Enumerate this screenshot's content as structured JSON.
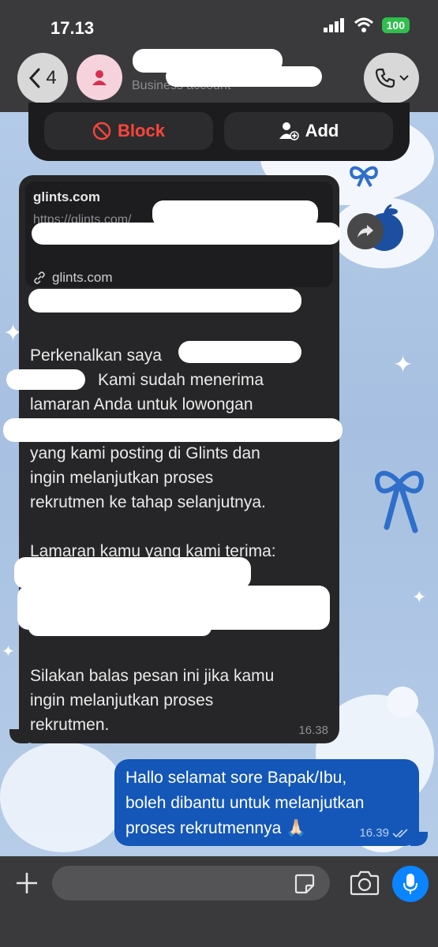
{
  "status_bar": {
    "time": "17.13",
    "battery": "100"
  },
  "header": {
    "back_count": "4",
    "contact_subtitle": "Business account"
  },
  "actions": {
    "block_label": "Block",
    "add_label": "Add"
  },
  "incoming": {
    "link_preview": {
      "title": "glints.com",
      "url": "https://glints.com/",
      "domain": "glints.com"
    },
    "paragraphs": [
      "Perkenalkan saya",
      "Kami sudah menerima",
      "lamaran Anda untuk lowongan",
      "yang kami posting di Glints dan",
      "ingin melanjutkan proses",
      "rekrutmen ke tahap selanjutnya.",
      "Lamaran kamu yang kami terima:",
      "Silakan balas pesan ini jika kamu",
      "ingin melanjutkan proses",
      "rekrutmen."
    ],
    "time": "16.38"
  },
  "outgoing": {
    "lines": [
      "Hallo selamat sore Bapak/Ibu,",
      "boleh dibantu untuk melanjutkan",
      "proses rekrutmennya 🙏🏻"
    ],
    "time": "16.39"
  },
  "icons": {
    "back": "chevron-left-icon",
    "avatar": "person-icon",
    "call": "phone-icon",
    "block": "block-icon",
    "add": "add-person-icon",
    "share": "share-icon",
    "link": "link-icon",
    "plus": "plus-icon",
    "sticker": "sticker-icon",
    "camera": "camera-icon",
    "mic": "microphone-icon",
    "read": "double-check-icon"
  },
  "colors": {
    "block": "#ff453a",
    "outgoing_bubble": "#1457b8",
    "mic_button": "#0a84ff",
    "battery": "#2fbf4d"
  }
}
